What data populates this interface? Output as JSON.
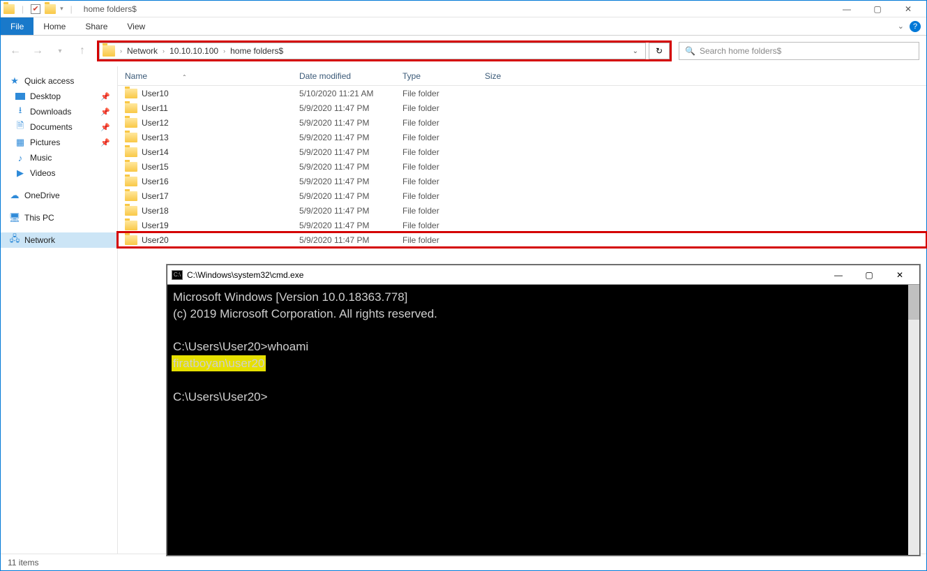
{
  "title": "home folders$",
  "ribbon": {
    "file": "File",
    "tabs": [
      "Home",
      "Share",
      "View"
    ]
  },
  "breadcrumbs": [
    "Network",
    "10.10.10.100",
    "home folders$"
  ],
  "search_placeholder": "Search home folders$",
  "columns": {
    "name": "Name",
    "date": "Date modified",
    "type": "Type",
    "size": "Size"
  },
  "sidebar": {
    "quick_access": "Quick access",
    "items_pinned": [
      "Desktop",
      "Downloads",
      "Documents",
      "Pictures"
    ],
    "items_plain": [
      "Music",
      "Videos"
    ],
    "onedrive": "OneDrive",
    "thispc": "This PC",
    "network": "Network"
  },
  "rows": [
    {
      "name": "User10",
      "date": "5/10/2020 11:21 AM",
      "type": "File folder"
    },
    {
      "name": "User11",
      "date": "5/9/2020 11:47 PM",
      "type": "File folder"
    },
    {
      "name": "User12",
      "date": "5/9/2020 11:47 PM",
      "type": "File folder"
    },
    {
      "name": "User13",
      "date": "5/9/2020 11:47 PM",
      "type": "File folder"
    },
    {
      "name": "User14",
      "date": "5/9/2020 11:47 PM",
      "type": "File folder"
    },
    {
      "name": "User15",
      "date": "5/9/2020 11:47 PM",
      "type": "File folder"
    },
    {
      "name": "User16",
      "date": "5/9/2020 11:47 PM",
      "type": "File folder"
    },
    {
      "name": "User17",
      "date": "5/9/2020 11:47 PM",
      "type": "File folder"
    },
    {
      "name": "User18",
      "date": "5/9/2020 11:47 PM",
      "type": "File folder"
    },
    {
      "name": "User19",
      "date": "5/9/2020 11:47 PM",
      "type": "File folder"
    },
    {
      "name": "User20",
      "date": "5/9/2020 11:47 PM",
      "type": "File folder",
      "highlight": true
    }
  ],
  "status": "11 items",
  "cmd": {
    "title": "C:\\Windows\\system32\\cmd.exe",
    "line1": "Microsoft Windows [Version 10.0.18363.778]",
    "line2": "(c) 2019 Microsoft Corporation. All rights reserved.",
    "prompt1": "C:\\Users\\User20>",
    "cmd1": "whoami",
    "out1": "firatboyan\\user20",
    "prompt2": "C:\\Users\\User20>"
  }
}
